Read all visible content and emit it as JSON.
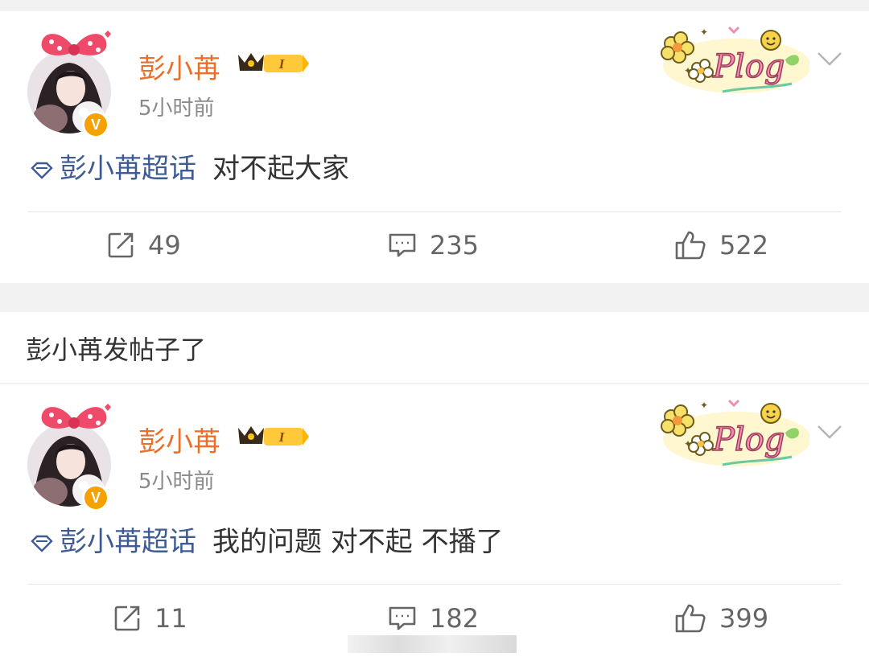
{
  "posts": [
    {
      "username": "彭小苒",
      "level_badge": "I",
      "timestamp": "5小时前",
      "topic": "彭小苒超话",
      "text": "对不起大家",
      "reposts": "49",
      "comments": "235",
      "likes": "522",
      "plog_label": "Plog"
    },
    {
      "username": "彭小苒",
      "level_badge": "I",
      "timestamp": "5小时前",
      "topic": "彭小苒超话",
      "text": "我的问题 对不起 不播了",
      "reposts": "11",
      "comments": "182",
      "likes": "399",
      "plog_label": "Plog"
    }
  ],
  "section_label": "彭小苒发帖子了",
  "colors": {
    "username": "#e8702a",
    "topic": "#3e5b94",
    "verified": "#f5a100",
    "text": "#333333",
    "meta": "#8a8a8a"
  },
  "icons": [
    "avatar",
    "bow-icon",
    "verified-icon",
    "crown-icon",
    "plog-sticker",
    "chevron-down-icon",
    "topic-diamond-icon",
    "repost-icon",
    "comment-icon",
    "like-icon"
  ]
}
